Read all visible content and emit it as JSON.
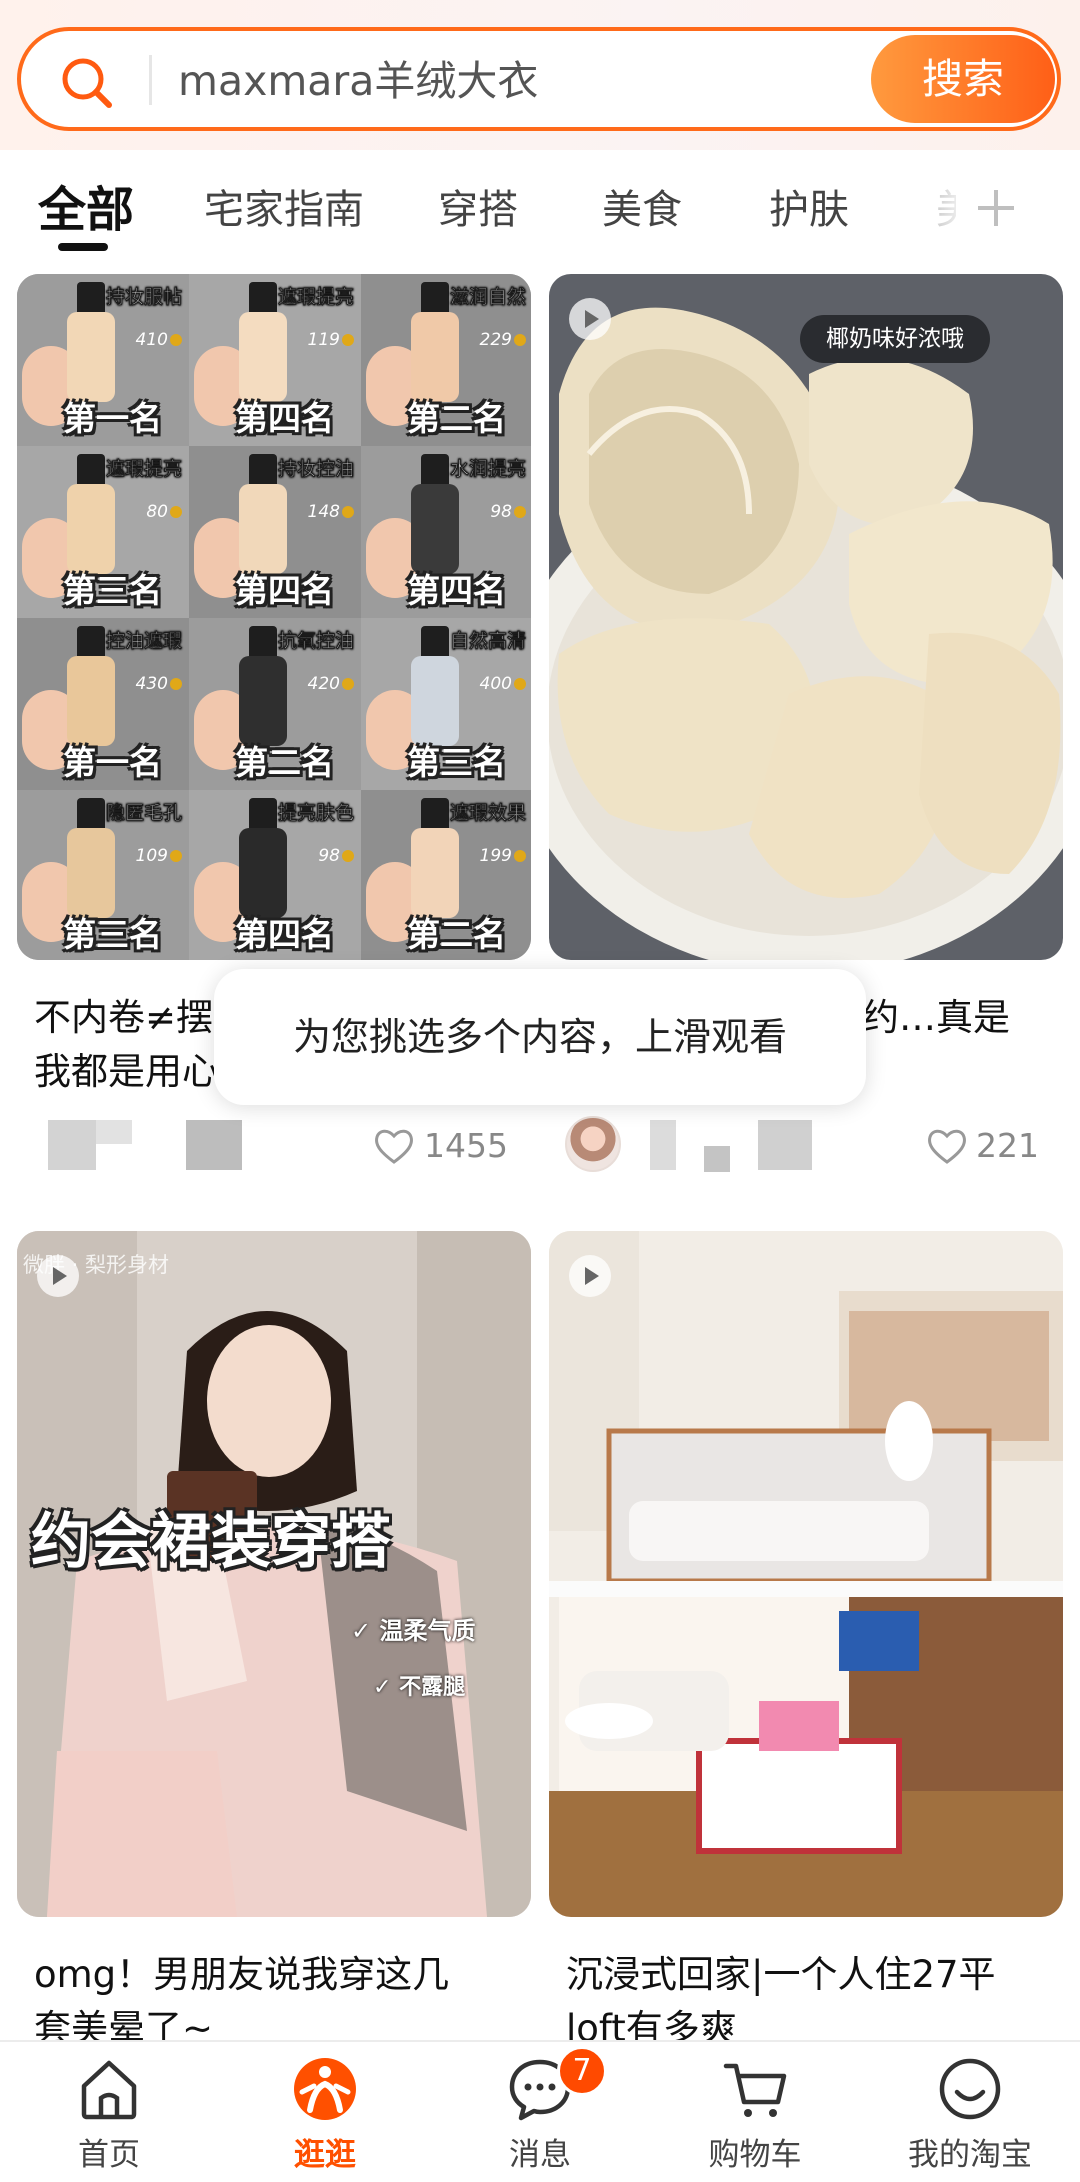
{
  "search": {
    "query": "maxmara羊绒大衣",
    "button_label": "搜索"
  },
  "tabs": [
    {
      "label": "全部",
      "active": true
    },
    {
      "label": "宅家指南"
    },
    {
      "label": "穿搭"
    },
    {
      "label": "美食"
    },
    {
      "label": "护肤"
    }
  ],
  "cards": {
    "foundation_ranking": {
      "title": "不内卷≠摆",
      "title_line2": "我都是用心",
      "likes": "1455",
      "grid": [
        {
          "tag": "持妆服帖",
          "price": "410",
          "rank": "第一名",
          "bottle": "#f2d7b6"
        },
        {
          "tag": "遮瑕提亮",
          "price": "119",
          "rank": "第四名",
          "bottle": "#f4dcc0"
        },
        {
          "tag": "滋润自然",
          "price": "229",
          "rank": "第二名",
          "bottle": "#f0c9a8"
        },
        {
          "tag": "遮瑕提亮",
          "price": "80",
          "rank": "第三名",
          "bottle": "#efd2ab"
        },
        {
          "tag": "持妆控油",
          "price": "148",
          "rank": "第四名",
          "bottle": "#f1d8ba"
        },
        {
          "tag": "水润提亮",
          "price": "98",
          "rank": "第四名",
          "bottle": "#3a3a3a"
        },
        {
          "tag": "控油遮瑕",
          "price": "430",
          "rank": "第一名",
          "bottle": "#e9c79a"
        },
        {
          "tag": "抗氧控油",
          "price": "420",
          "rank": "第二名",
          "bottle": "#2f2f2f"
        },
        {
          "tag": "自然高清",
          "price": "400",
          "rank": "第三名",
          "bottle": "#cfd6de"
        },
        {
          "tag": "隐匿毛孔",
          "price": "109",
          "rank": "第三名",
          "bottle": "#e7c79c"
        },
        {
          "tag": "提亮肤色",
          "price": "98",
          "rank": "第四名",
          "bottle": "#2a2a2a"
        },
        {
          "tag": "遮瑕效果",
          "price": "199",
          "rank": "第二名",
          "bottle": "#f2d4b8"
        }
      ]
    },
    "coconut_rice": {
      "bubble": "椰奶味好浓哦",
      "title": "约…真是",
      "likes": "221"
    },
    "date_outfit": {
      "corner_tag": "微胖 · 梨形身材",
      "headline": "约会裙装穿搭",
      "check1": "温柔气质",
      "check2": "不露腿",
      "title_line1": "omg！男朋友说我穿这几",
      "title_line2": "套美晕了~"
    },
    "loft_room": {
      "title_line1": "沉浸式回家|一个人住27平",
      "title_line2": "loft有多爽"
    }
  },
  "toast": "为您挑选多个内容，上滑观看",
  "bottom_nav": [
    {
      "label": "首页",
      "icon": "home-icon"
    },
    {
      "label": "逛逛",
      "icon": "guangguang-icon",
      "active": true
    },
    {
      "label": "消息",
      "icon": "message-icon",
      "badge": "7"
    },
    {
      "label": "购物车",
      "icon": "cart-icon"
    },
    {
      "label": "我的淘宝",
      "icon": "profile-icon"
    }
  ],
  "colors": {
    "accent": "#ff5000",
    "search_border": "#ff6a1a"
  }
}
